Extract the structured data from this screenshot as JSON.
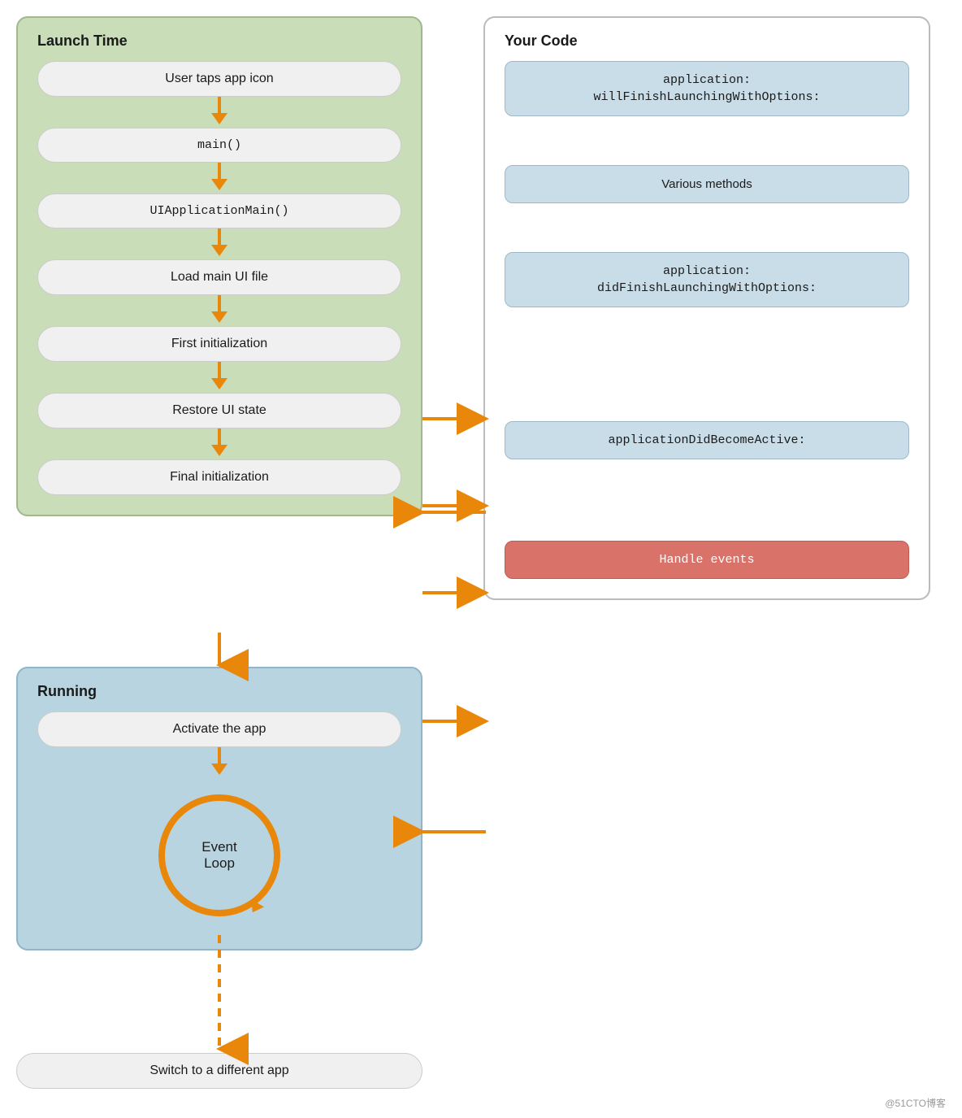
{
  "diagram": {
    "launch_time": {
      "title": "Launch Time",
      "steps": [
        {
          "id": "user-taps",
          "label": "User taps app icon",
          "mono": false
        },
        {
          "id": "main",
          "label": "main()",
          "mono": true
        },
        {
          "id": "uiappmain",
          "label": "UIApplicationMain()",
          "mono": true
        },
        {
          "id": "load-ui",
          "label": "Load main UI file",
          "mono": false
        },
        {
          "id": "first-init",
          "label": "First initialization",
          "mono": false
        },
        {
          "id": "restore-ui",
          "label": "Restore UI state",
          "mono": false
        },
        {
          "id": "final-init",
          "label": "Final initialization",
          "mono": false
        }
      ]
    },
    "running": {
      "title": "Running",
      "steps": [
        {
          "id": "activate",
          "label": "Activate the app",
          "mono": false
        },
        {
          "id": "event-loop",
          "line1": "Event",
          "line2": "Loop"
        }
      ]
    },
    "switch": {
      "label": "Switch to a different app"
    },
    "your_code": {
      "title": "Your Code",
      "items": [
        {
          "id": "will-finish",
          "label": "application:\nwillFinishLaunchingWithOptions:",
          "mono": true,
          "style": "blue"
        },
        {
          "id": "various",
          "label": "Various methods",
          "mono": false,
          "style": "blue"
        },
        {
          "id": "did-finish",
          "label": "application:\ndidFinishLaunchingWithOptions:",
          "mono": true,
          "style": "blue"
        },
        {
          "id": "did-become-active",
          "label": "applicationDidBecomeActive:",
          "mono": true,
          "style": "blue"
        },
        {
          "id": "handle-events",
          "label": "Handle events",
          "mono": false,
          "style": "red"
        }
      ]
    },
    "watermark": "@51CTO博客"
  }
}
